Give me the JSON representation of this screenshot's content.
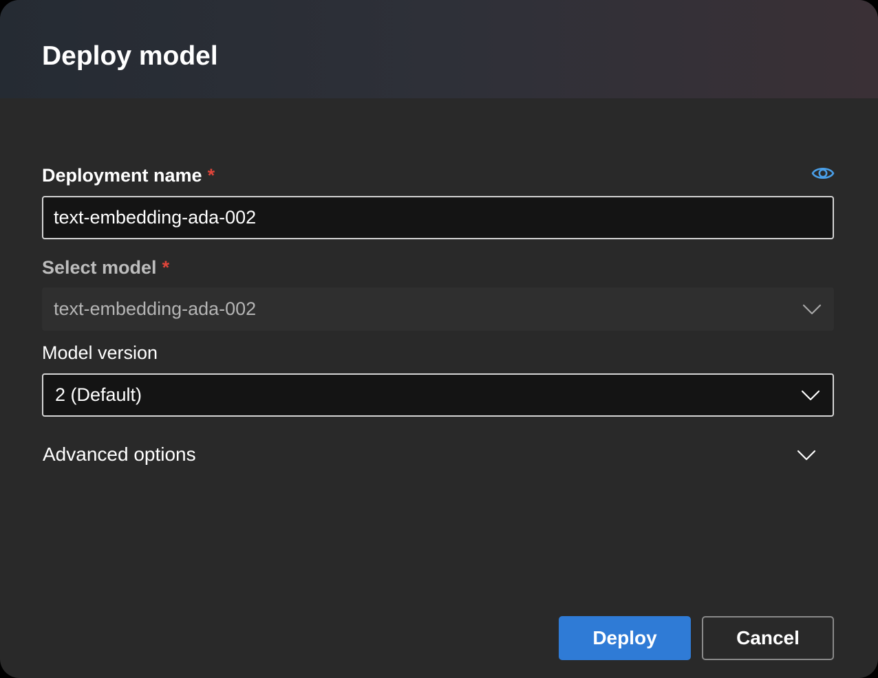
{
  "dialog": {
    "title": "Deploy model"
  },
  "form": {
    "deployment_name": {
      "label": "Deployment name",
      "required_marker": "*",
      "value": "text-embedding-ada-002"
    },
    "select_model": {
      "label": "Select model",
      "required_marker": "*",
      "value": "text-embedding-ada-002",
      "disabled": true
    },
    "model_version": {
      "label": "Model version",
      "value": "2 (Default)"
    },
    "advanced_options": {
      "label": "Advanced options",
      "expanded": false
    }
  },
  "buttons": {
    "deploy_label": "Deploy",
    "cancel_label": "Cancel"
  },
  "icons": {
    "visibility": "eye-icon",
    "dropdown": "chevron-down-icon"
  },
  "colors": {
    "accent": "#2f7bd6",
    "required": "#e0453a",
    "eye_icon": "#4a9fe8"
  }
}
